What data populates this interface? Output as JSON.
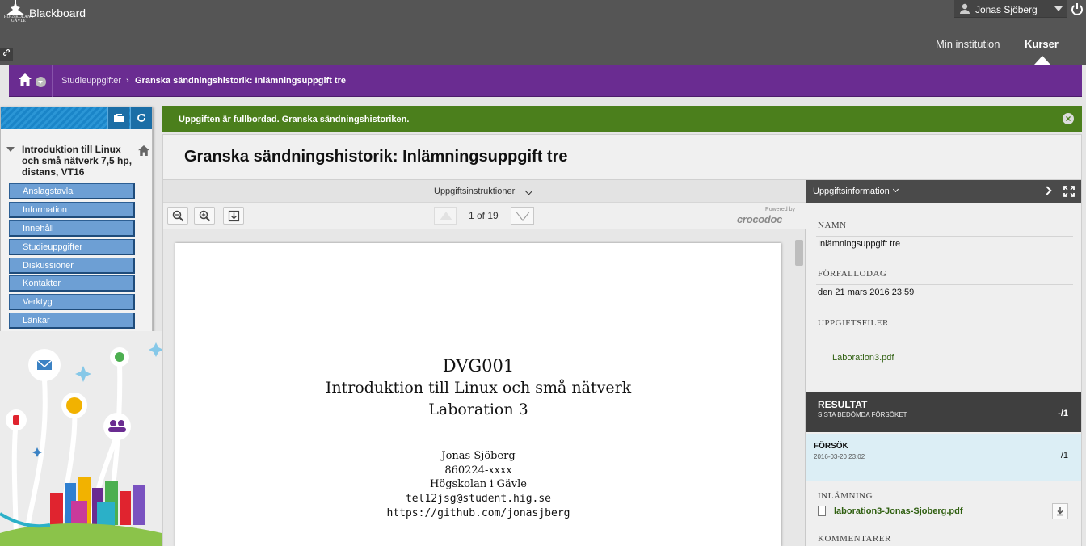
{
  "header": {
    "logo_text": "HÖGSKOLAN I GÄVLE",
    "brand": "Blackboard",
    "user_name": "Jonas Sjöberg",
    "tabs": [
      {
        "label": "Min institution"
      },
      {
        "label": "Kurser"
      }
    ]
  },
  "breadcrumb": {
    "parent": "Studieuppgifter",
    "separator": "›",
    "current": "Granska sändningshistorik: Inlämningsuppgift tre"
  },
  "course_menu": {
    "title": "Introduktion till Linux och små nätverk 7,5 hp, distans, VT16",
    "items": [
      {
        "label": "Anslagstavla"
      },
      {
        "label": "Information"
      },
      {
        "label": "Innehåll"
      },
      {
        "label": "Studieuppgifter"
      },
      {
        "label": "Diskussioner"
      },
      {
        "label": "Kontakter"
      },
      {
        "label": "Verktyg"
      },
      {
        "label": "Länkar"
      }
    ]
  },
  "message": {
    "text": "Uppgiften är fullbordad. Granska sändningshistoriken.",
    "color": "#4b7f1c"
  },
  "page": {
    "title": "Granska sändningshistorik: Inlämningsuppgift tre"
  },
  "viewer": {
    "instructions_label": "Uppgiftsinstruktioner",
    "page_indicator": "1 of 19",
    "powered_by": "Powered by",
    "provider": "crocodoc"
  },
  "document": {
    "course_code": "DVG001",
    "course_name": "Introduktion till Linux och små nätverk",
    "lab": "Laboration 3",
    "author": "Jonas Sjöberg",
    "id": "860224-xxxx",
    "school": "Högskolan i Gävle",
    "email": "tel12jsg@student.hig.se",
    "url": "https://github.com/jonasjberg"
  },
  "info_panel": {
    "header": "Uppgiftsinformation",
    "name_label": "NAMN",
    "name_value": "Inlämningsuppgift tre",
    "due_label": "FÖRFALLODAG",
    "due_value": "den 21 mars 2016 23:59",
    "files_label": "UPPGIFTSFILER",
    "file_name": "Laboration3.pdf",
    "result_title": "RESULTAT",
    "result_sub": "SISTA BEDÖMDA FÖRSÖKET",
    "result_score": "-/1",
    "attempt_title": "FÖRSÖK",
    "attempt_date": "2016-03-20 23:02",
    "attempt_score": "/1",
    "submission_label": "INLÄMNING",
    "submission_file": "laboration3-Jonas-Sjoberg.pdf",
    "comments_label": "KOMMENTARER"
  },
  "colors": {
    "header_bg": "#555555",
    "breadcrumb_bg": "#6a2c91",
    "menu_item_bg": "#6d9fd4",
    "attempt_bg": "#dceef5"
  }
}
